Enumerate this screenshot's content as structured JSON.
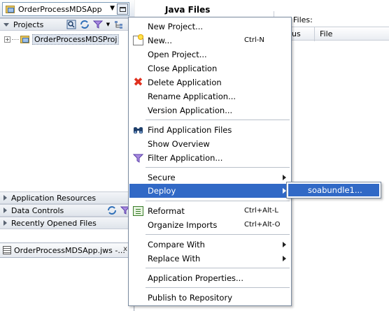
{
  "navigator": {
    "app_name": "OrderProcessMDSApp",
    "projects_label": "Projects",
    "project_item": "OrderProcessMDSProj",
    "expand_glyph": "+",
    "sections": [
      "Application Resources",
      "Data Controls",
      "Recently Opened Files"
    ],
    "jws_tab": "OrderProcessMDSApp.jws -...",
    "close_glyph": "x"
  },
  "editor": {
    "tab_title": "Java Files",
    "files_label": "Files:",
    "col_status": "us",
    "col_file": "File"
  },
  "menu": {
    "items": [
      {
        "label": "New Project...",
        "accel": "",
        "icon": ""
      },
      {
        "label": "New...",
        "accel": "Ctrl-N",
        "icon": "new-icon"
      },
      {
        "label": "Open Project...",
        "accel": "",
        "icon": ""
      },
      {
        "label": "Close Application",
        "accel": "",
        "icon": ""
      },
      {
        "label": "Delete Application",
        "accel": "",
        "icon": "delete-icon"
      },
      {
        "label": "Rename Application...",
        "accel": "",
        "icon": ""
      },
      {
        "label": "Version Application...",
        "accel": "",
        "icon": ""
      },
      {
        "label": "Find Application Files",
        "accel": "",
        "icon": "binoculars-icon"
      },
      {
        "label": "Show Overview",
        "accel": "",
        "icon": ""
      },
      {
        "label": "Filter Application...",
        "accel": "",
        "icon": "filter-icon"
      },
      {
        "label": "Secure",
        "accel": "",
        "icon": "",
        "submenu": true
      },
      {
        "label": "Deploy",
        "accel": "",
        "icon": "",
        "submenu": true,
        "active": true
      },
      {
        "label": "Reformat",
        "accel": "Ctrl+Alt-L",
        "icon": "reformat-icon"
      },
      {
        "label": "Organize Imports",
        "accel": "Ctrl+Alt-O",
        "icon": ""
      },
      {
        "label": "Compare With",
        "accel": "",
        "icon": "",
        "submenu": true
      },
      {
        "label": "Replace With",
        "accel": "",
        "icon": "",
        "submenu": true
      },
      {
        "label": "Application Properties...",
        "accel": "",
        "icon": ""
      },
      {
        "label": "Publish to Repository",
        "accel": "",
        "icon": ""
      }
    ]
  },
  "submenu": {
    "deploy_item": "soabundle1..."
  },
  "colors": {
    "highlight": "#3169c6",
    "delete_red": "#e0301e"
  }
}
